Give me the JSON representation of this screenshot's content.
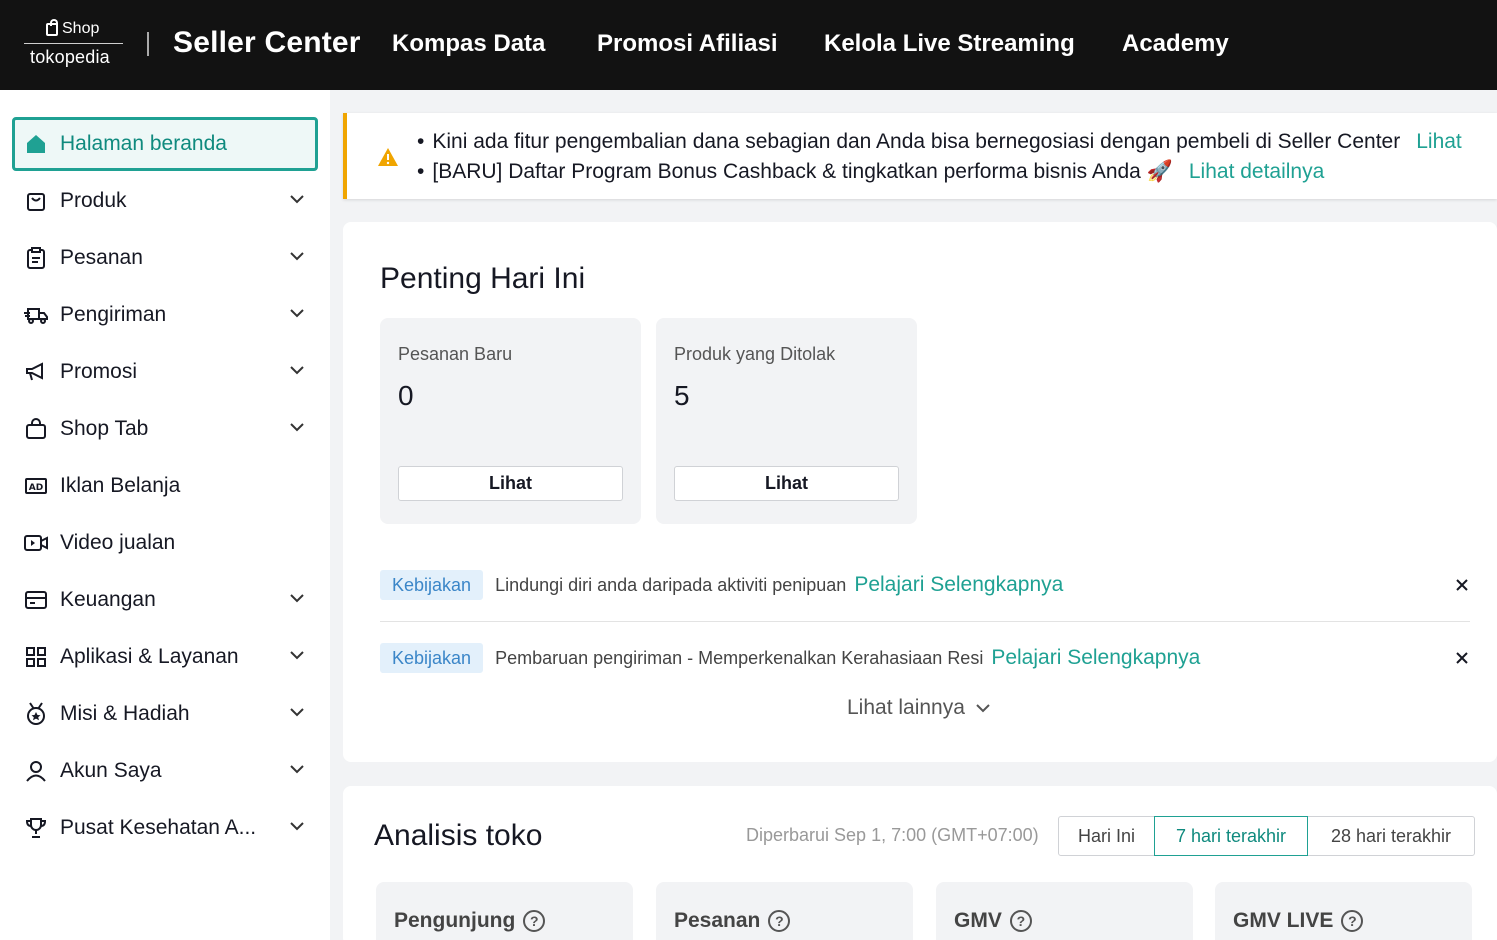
{
  "header": {
    "logo_shop": "Shop",
    "logo_brand": "tokopedia",
    "title": "Seller Center",
    "nav": [
      "Kompas Data",
      "Promosi Afiliasi",
      "Kelola Live Streaming",
      "Academy"
    ]
  },
  "sidebar": {
    "items": [
      {
        "label": "Halaman beranda",
        "icon": "home-icon",
        "expandable": false
      },
      {
        "label": "Produk",
        "icon": "product-bag-icon",
        "expandable": true
      },
      {
        "label": "Pesanan",
        "icon": "clipboard-icon",
        "expandable": true
      },
      {
        "label": "Pengiriman",
        "icon": "truck-icon",
        "expandable": true
      },
      {
        "label": "Promosi",
        "icon": "megaphone-icon",
        "expandable": true
      },
      {
        "label": "Shop Tab",
        "icon": "shopping-bag-icon",
        "expandable": true
      },
      {
        "label": "Iklan Belanja",
        "icon": "ad-icon",
        "expandable": false
      },
      {
        "label": "Video jualan",
        "icon": "video-icon",
        "expandable": false
      },
      {
        "label": "Keuangan",
        "icon": "wallet-icon",
        "expandable": true
      },
      {
        "label": "Aplikasi & Layanan",
        "icon": "apps-grid-icon",
        "expandable": true
      },
      {
        "label": "Misi & Hadiah",
        "icon": "medal-icon",
        "expandable": true
      },
      {
        "label": "Akun Saya",
        "icon": "user-icon",
        "expandable": true
      },
      {
        "label": "Pusat Kesehatan A...",
        "icon": "trophy-icon",
        "expandable": true
      }
    ]
  },
  "notice": {
    "items": [
      {
        "text": "Kini ada fitur pengembalian dana sebagian dan Anda bisa bernegosiasi dengan pembeli di Seller Center",
        "link": "Lihat"
      },
      {
        "text": "[BARU] Daftar Program Bonus Cashback & tingkatkan performa bisnis Anda 🚀",
        "link": "Lihat detailnya"
      }
    ]
  },
  "today": {
    "title": "Penting Hari Ini",
    "stats": [
      {
        "label": "Pesanan Baru",
        "value": "0",
        "button": "Lihat"
      },
      {
        "label": "Produk yang Ditolak",
        "value": "5",
        "button": "Lihat"
      }
    ],
    "policies": [
      {
        "tag": "Kebijakan",
        "text": "Lindungi diri anda daripada aktiviti penipuan",
        "link": "Pelajari Selengkapnya"
      },
      {
        "tag": "Kebijakan",
        "text": "Pembaruan pengiriman - Memperkenalkan Kerahasiaan Resi",
        "link": "Pelajari Selengkapnya"
      }
    ],
    "more": "Lihat lainnya"
  },
  "analysis": {
    "title": "Analisis toko",
    "updated": "Diperbarui Sep 1, 7:00 (GMT+07:00)",
    "ranges": [
      "Hari Ini",
      "7 hari terakhir",
      "28 hari terakhir"
    ],
    "selected_range": "7 hari terakhir",
    "metrics": [
      "Pengunjung",
      "Pesanan",
      "GMV",
      "GMV LIVE"
    ]
  },
  "colors": {
    "accent": "#1fa193",
    "warning": "#f0a500",
    "header_bg": "#121212"
  }
}
